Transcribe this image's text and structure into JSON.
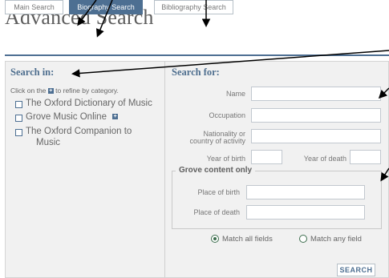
{
  "page_title": "Advanced Search",
  "tabs": [
    {
      "label": "Main Search",
      "active": false
    },
    {
      "label": "Biography Search",
      "active": true
    },
    {
      "label": "Bibliography Search",
      "active": false
    }
  ],
  "search_in": {
    "heading": "Search in:",
    "hint_before": "Click on the",
    "hint_after": "to refine by category.",
    "categories": [
      {
        "label": "The Oxford Dictionary of Music",
        "checked": false
      },
      {
        "label": "Grove Music Online",
        "checked": false,
        "expandable": true
      },
      {
        "label": "The Oxford Companion to",
        "label_line2": "Music",
        "checked": false
      }
    ]
  },
  "search_for": {
    "heading": "Search for:",
    "name_label": "Name",
    "occupation_label": "Occupation",
    "nationality_label_line1": "Nationality or",
    "nationality_label_line2": "country of activity",
    "year_birth_label": "Year of birth",
    "year_death_label": "Year of death",
    "grove_legend": "Grove content only",
    "place_birth_label": "Place of birth",
    "place_death_label": "Place of death",
    "match_all_label": "Match all fields",
    "match_any_label": "Match any field",
    "match_selected": "all",
    "search_button": "SEARCH"
  },
  "colors": {
    "accent": "#4d6f92",
    "heading": "#4f6f8f",
    "panel_bg": "#f1f1f1",
    "radio": "#3d6e4e"
  }
}
